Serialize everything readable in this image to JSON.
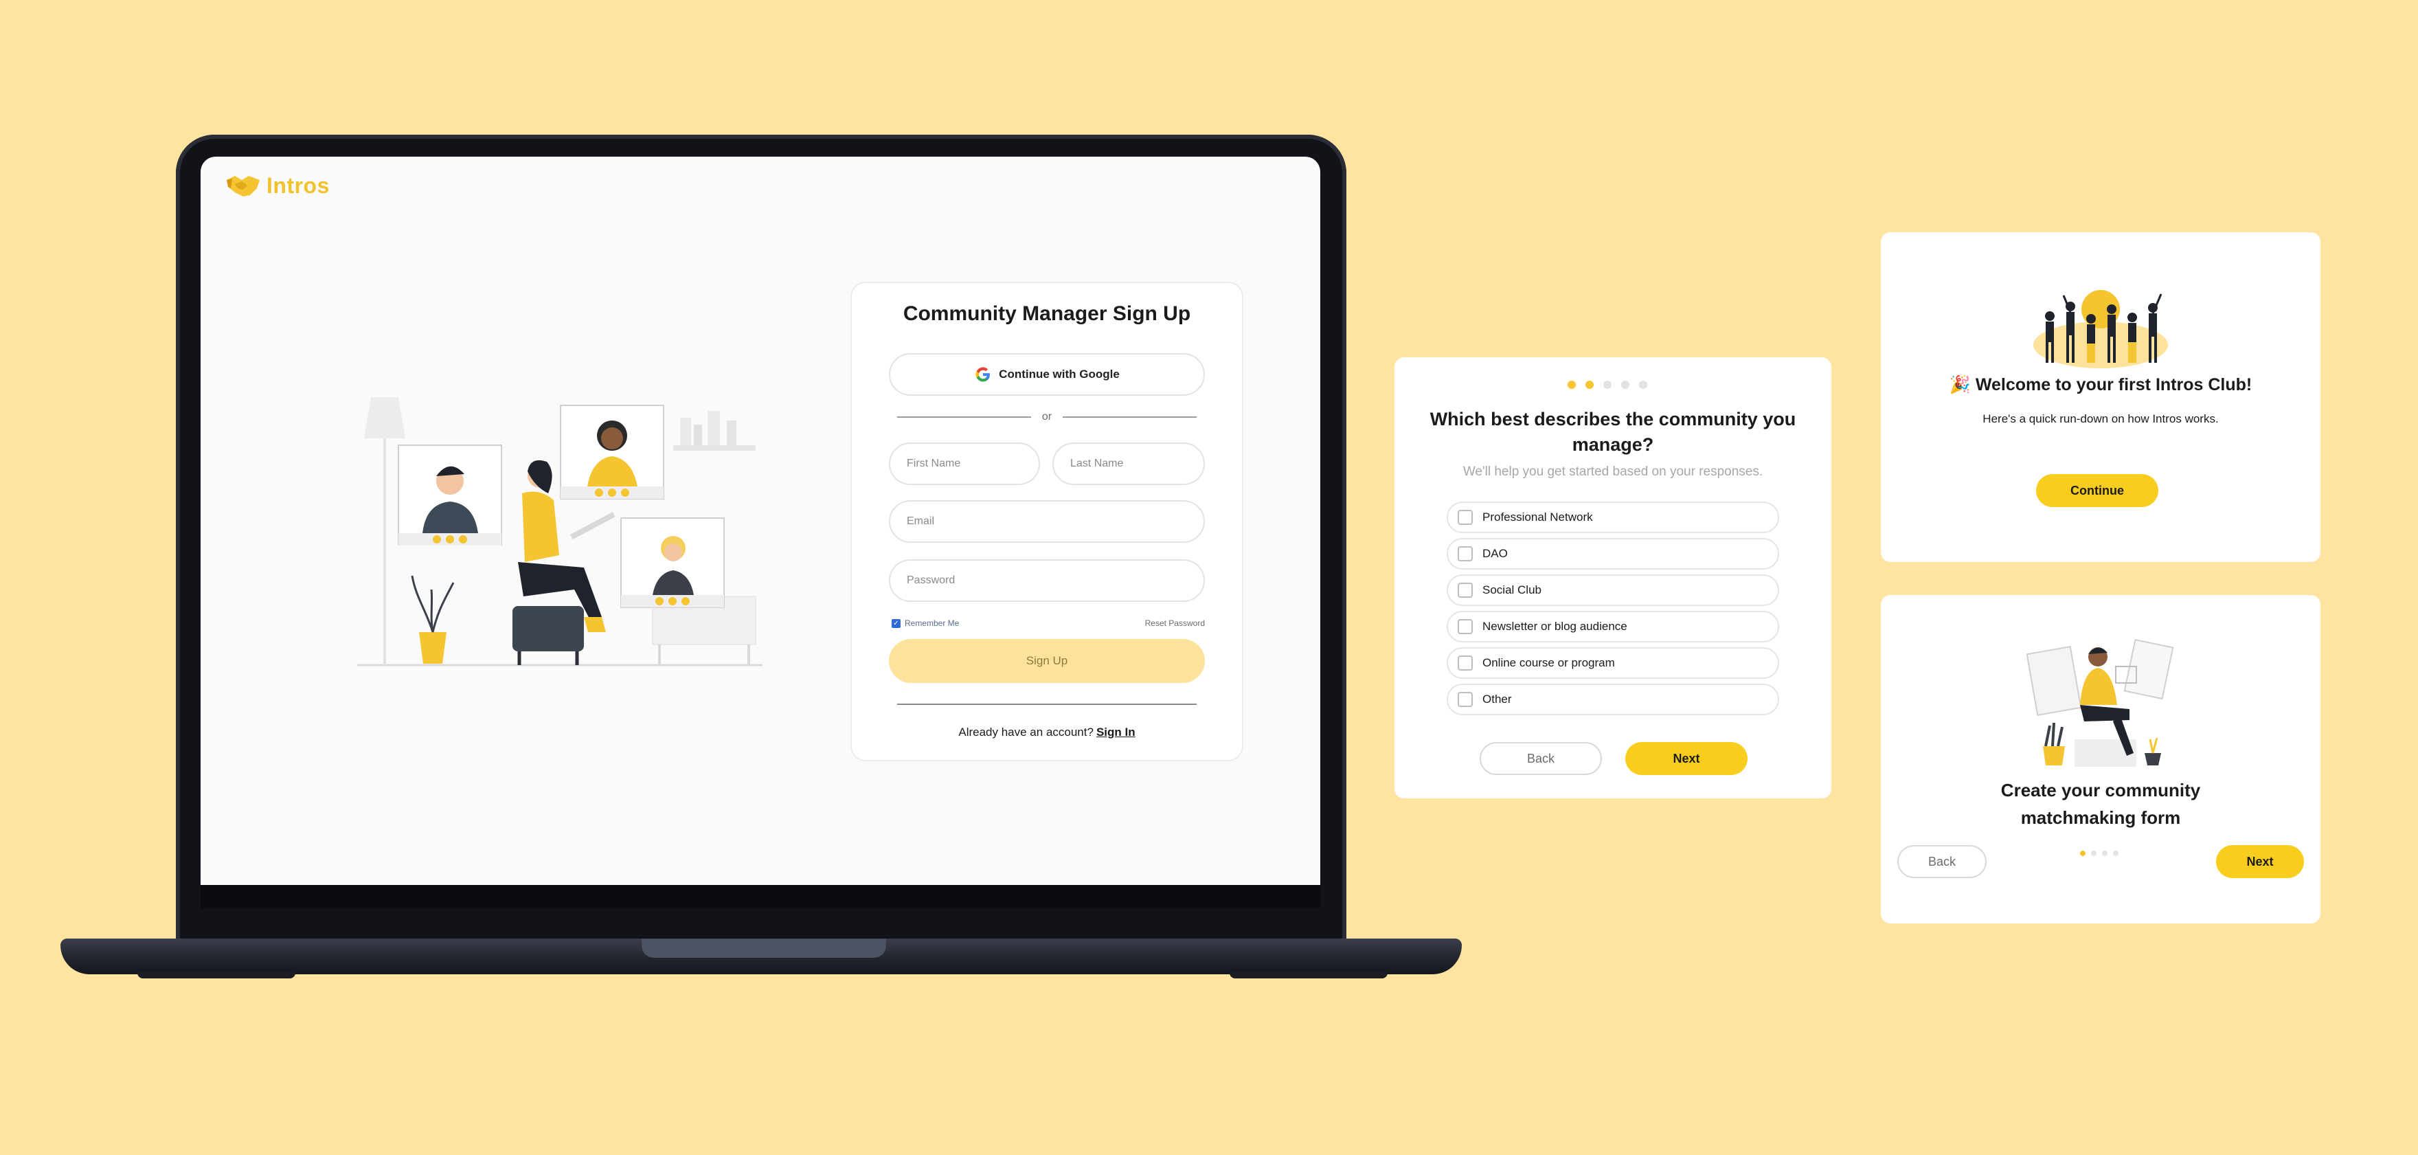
{
  "laptop": {
    "logo_text": "Intros",
    "signup": {
      "title": "Community Manager Sign Up",
      "google_label": "Continue with Google",
      "or_label": "or",
      "first_name_placeholder": "First Name",
      "last_name_placeholder": "Last Name",
      "email_placeholder": "Email",
      "password_placeholder": "Password",
      "remember_label": "Remember Me",
      "remember_checked": true,
      "reset_label": "Reset Password",
      "signup_label": "Sign Up",
      "already_text": "Already have an account?",
      "signin_label": "Sign In"
    }
  },
  "type_card": {
    "step_dots": {
      "total": 5,
      "active": 2
    },
    "title": "Which best describes the community you manage?",
    "subtitle": "We'll help you get started based on your responses.",
    "options": [
      "Professional Network",
      "DAO",
      "Social Club",
      "Newsletter or blog audience",
      "Online course or program",
      "Other"
    ],
    "back_label": "Back",
    "next_label": "Next"
  },
  "welcome_card": {
    "title": "🎉 Welcome to your first Intros Club!",
    "subtitle": "Here's a quick run-down on how Intros works.",
    "continue_label": "Continue"
  },
  "form_card": {
    "title_line1": "Create your community",
    "title_line2": "matchmaking form",
    "step_dots": {
      "total": 4,
      "active": 1
    },
    "back_label": "Back",
    "next_label": "Next"
  },
  "colors": {
    "background": "#FFE3A0",
    "accent_yellow": "#F9CD1E",
    "signup_button_disabled": "#FCE29A",
    "logo_yellow": "#F2C12E"
  }
}
